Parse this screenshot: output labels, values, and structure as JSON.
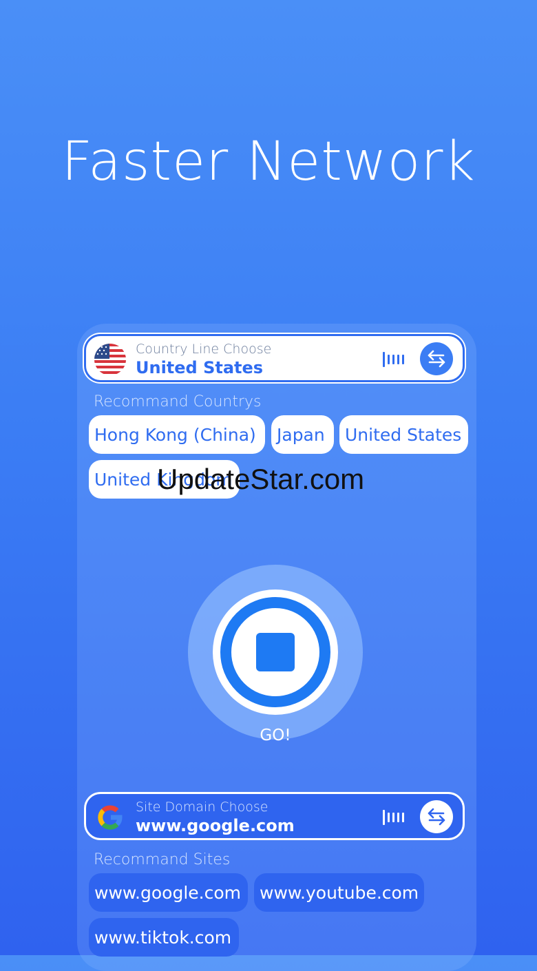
{
  "headline": "Faster Network",
  "country_selector": {
    "label": "Country Line Choose",
    "value": "United States",
    "flag_icon": "us-flag-icon",
    "signal_icon": "signal-bars-icon",
    "swap_icon": "swap-arrows-icon"
  },
  "recommend_countries": {
    "title": "Recommand Countrys",
    "items": [
      "Hong Kong (China)",
      "Japan",
      "United States",
      "United Kingdom"
    ]
  },
  "go_button": {
    "label": "GO!",
    "icon": "stop-square-icon"
  },
  "site_selector": {
    "label": "Site Domain Choose",
    "value": "www.google.com",
    "site_icon": "google-g-icon",
    "signal_icon": "signal-bars-icon",
    "swap_icon": "swap-arrows-icon"
  },
  "recommend_sites": {
    "title": "Recommand Sites",
    "items": [
      "www.google.com",
      "www.youtube.com",
      "www.tiktok.com"
    ]
  },
  "watermark": "UpdateStar.com",
  "colors": {
    "primary": "#2f6cf0",
    "accent": "#1e7af3",
    "background_top": "#4a8ff7",
    "background_bottom": "#2f62ef"
  }
}
